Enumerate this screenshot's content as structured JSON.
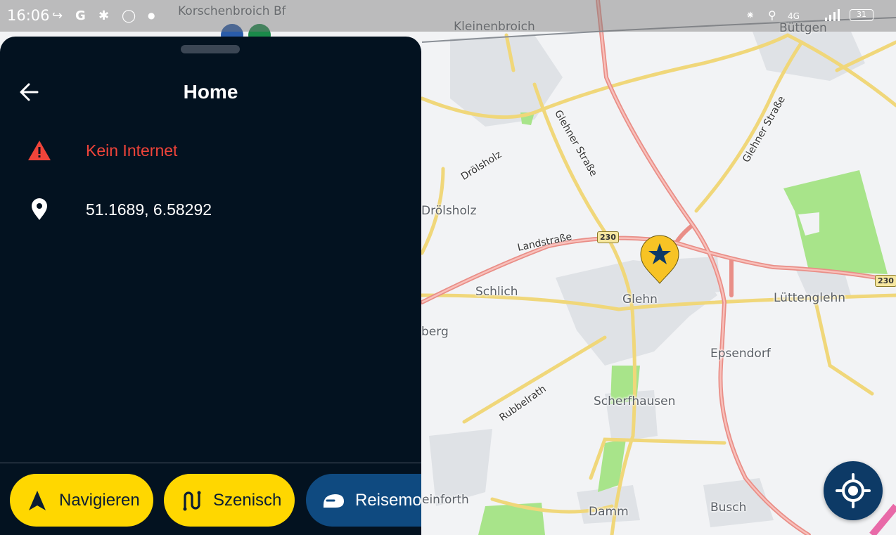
{
  "status_bar": {
    "time": "16:06",
    "network": "4G",
    "battery": "31"
  },
  "map": {
    "place_labels": {
      "korschenbroich_bf": "Korschenbroich Bf",
      "kleinenbroich": "Kleinenbroich",
      "buettgen": "Büttgen",
      "droelsholz_road": "Drölsholz",
      "droelsholz": "Drölsholz",
      "schlich": "Schlich",
      "glehn": "Glehn",
      "luettenglehn": "Lüttenglehn",
      "epsendorf": "Epsendorf",
      "scherfhausen": "Scherfhausen",
      "berg": "berg",
      "einforth": "einforth",
      "damm": "Damm",
      "busch": "Busch"
    },
    "road_labels": {
      "glehner_strasse_1": "Glehner Straße",
      "glehner_strasse_2": "Glehner Straße",
      "landstrasse": "Landstraße",
      "rubbelrath": "Rubbelrath"
    },
    "route_numbers": {
      "b230_a": "230",
      "b230_b": "230"
    },
    "colors": {
      "main_road": "#f29a93",
      "secondary_road": "#f3e28a",
      "park": "#a8e48a",
      "marker": "#f7c325"
    }
  },
  "sheet": {
    "title": "Home",
    "warning_text": "Kein Internet",
    "coordinates": "51.1689, 6.58292",
    "warning_color": "#f0443a"
  },
  "actions": {
    "navigate_label": "Navigieren",
    "scenic_label": "Szenisch",
    "travel_mode_label": "Reisemodus"
  },
  "icons": {
    "back": "arrow-left-icon",
    "warning": "warning-icon",
    "location": "location-pin-icon",
    "navigate": "navigation-arrow-icon",
    "scenic": "winding-route-icon",
    "travel_mode": "vehicle-mode-icon",
    "locate": "gps-locate-icon"
  }
}
